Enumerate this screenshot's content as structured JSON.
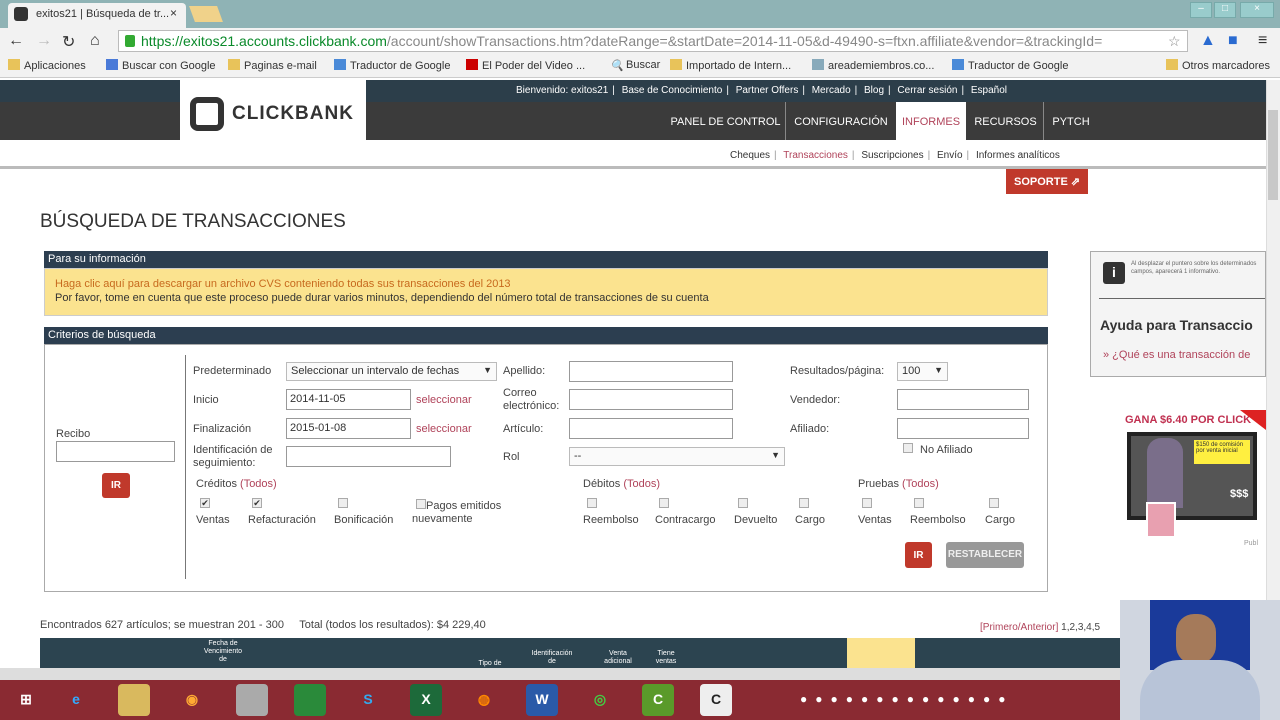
{
  "browser": {
    "tab_title": "exitos21 | Búsqueda de tr...",
    "url_host": "https://exitos21.accounts.clickbank.com",
    "url_path": "/account/showTransactions.htm?dateRange=&startDate=2014-11-05&d-49490-s=ftxn.affiliate&vendor=&trackingId=",
    "bookmarks": [
      "Aplicaciones",
      "Buscar con Google",
      "Paginas e-mail",
      "Traductor de Google",
      "El Poder del Video ...",
      "Buscar",
      "Importado de Intern...",
      "areademiembros.co...",
      "Traductor de Google"
    ],
    "other_bookmarks": "Otros marcadores"
  },
  "header": {
    "logo": "CLICKBANK",
    "top_links": [
      "Bienvenido: exitos21",
      "Base de Conocimiento",
      "Partner Offers",
      "Mercado",
      "Blog",
      "Cerrar sesión",
      "Español"
    ],
    "main_nav": [
      "PANEL DE CONTROL",
      "CONFIGURACIÓN",
      "INFORMES",
      "RECURSOS",
      "PYTCH"
    ],
    "active_nav": "INFORMES",
    "sub_nav": [
      "Cheques",
      "Transacciones",
      "Suscripciones",
      "Envío",
      "Informes analíticos"
    ],
    "support": "SOPORTE"
  },
  "page": {
    "title": "BÚSQUEDA DE TRANSACCIONES",
    "info": {
      "header": "Para su información",
      "link": "Haga clic aquí para descargar un archivo CVS conteniendo todas sus transacciones del 2013",
      "note": "Por favor, tome en cuenta que este proceso puede durar varios minutos, dependiendo del número total de transacciones de su cuenta"
    },
    "criteria": {
      "header": "Criterios de búsqueda",
      "receipt_label": "Recibo",
      "go": "IR",
      "preset_label": "Predeterminado",
      "preset_value": "Seleccionar un intervalo de fechas",
      "start_label": "Inicio",
      "start_value": "2014-11-05",
      "end_label": "Finalización",
      "end_value": "2015-01-08",
      "select_link": "seleccionar",
      "tracking_label_1": "Identificación de",
      "tracking_label_2": "seguimiento:",
      "lastname_label": "Apellido:",
      "email_label_1": "Correo",
      "email_label_2": "electrónico:",
      "item_label": "Artículo:",
      "role_label": "Rol",
      "role_value": "--",
      "per_page_label": "Resultados/página:",
      "per_page_value": "100",
      "vendor_label": "Vendedor:",
      "affiliate_label": "Afiliado:",
      "no_affiliate": "No Afiliado",
      "credits_label": "Créditos",
      "debits_label": "Débitos",
      "tests_label": "Pruebas",
      "all": "(Todos)",
      "credits": [
        {
          "label": "Ventas",
          "checked": true
        },
        {
          "label": "Refacturación",
          "checked": true
        },
        {
          "label": "Bonificación",
          "checked": false
        },
        {
          "label": "Pagos emitidos nuevamente",
          "checked": false
        }
      ],
      "debits": [
        {
          "label": "Reembolso",
          "checked": false
        },
        {
          "label": "Contracargo",
          "checked": false
        },
        {
          "label": "Devuelto",
          "checked": false
        },
        {
          "label": "Cargo",
          "checked": false
        }
      ],
      "tests": [
        {
          "label": "Ventas",
          "checked": false
        },
        {
          "label": "Reembolso",
          "checked": false
        },
        {
          "label": "Cargo",
          "checked": false
        }
      ],
      "reset": "RESTABLECER"
    },
    "results": {
      "found": "Encontrados 627 artículos; se muestran 201 - 300",
      "total": "Total (todos los resultados): $4 229,40",
      "pager_link": "[Primero/Anterior]",
      "pages": "1,2,3,4,5"
    },
    "table_headers": [
      "Fecha de Vencimiento de",
      "Tipo de",
      "Identificación de",
      "Venta adicional",
      "Tiene ventas"
    ]
  },
  "sidebar": {
    "tip": "Al desplazar el puntero sobre los determinados campos, aparecerá 1 informativo.",
    "help_title": "Ayuda para Transaccio",
    "help_link": "» ¿Qué es una transacción de",
    "ad_title": "GANA $6.40 POR CLICK",
    "ad_caption": "$150 de comisión por venta inicial",
    "ad_money": "$$$",
    "ad_footer": "Publ"
  },
  "colors": {
    "accent": "#c0392b",
    "header": "#2c3e50",
    "info_bg": "#fbe38f",
    "link": "#b0435a"
  }
}
